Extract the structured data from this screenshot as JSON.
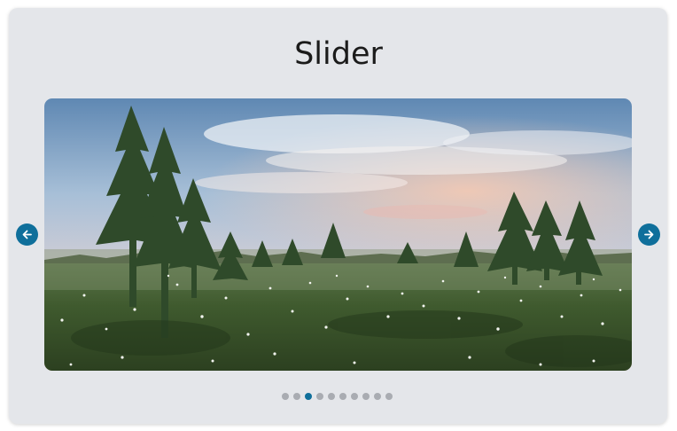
{
  "slider": {
    "title": "Slider",
    "current_slide": 3,
    "total_slides": 10,
    "prev_icon": "arrow-left-icon",
    "next_icon": "arrow-right-icon"
  },
  "colors": {
    "accent": "#0f6f9b",
    "dot_inactive": "#a9acb2",
    "card_background": "#e4e6ea"
  }
}
